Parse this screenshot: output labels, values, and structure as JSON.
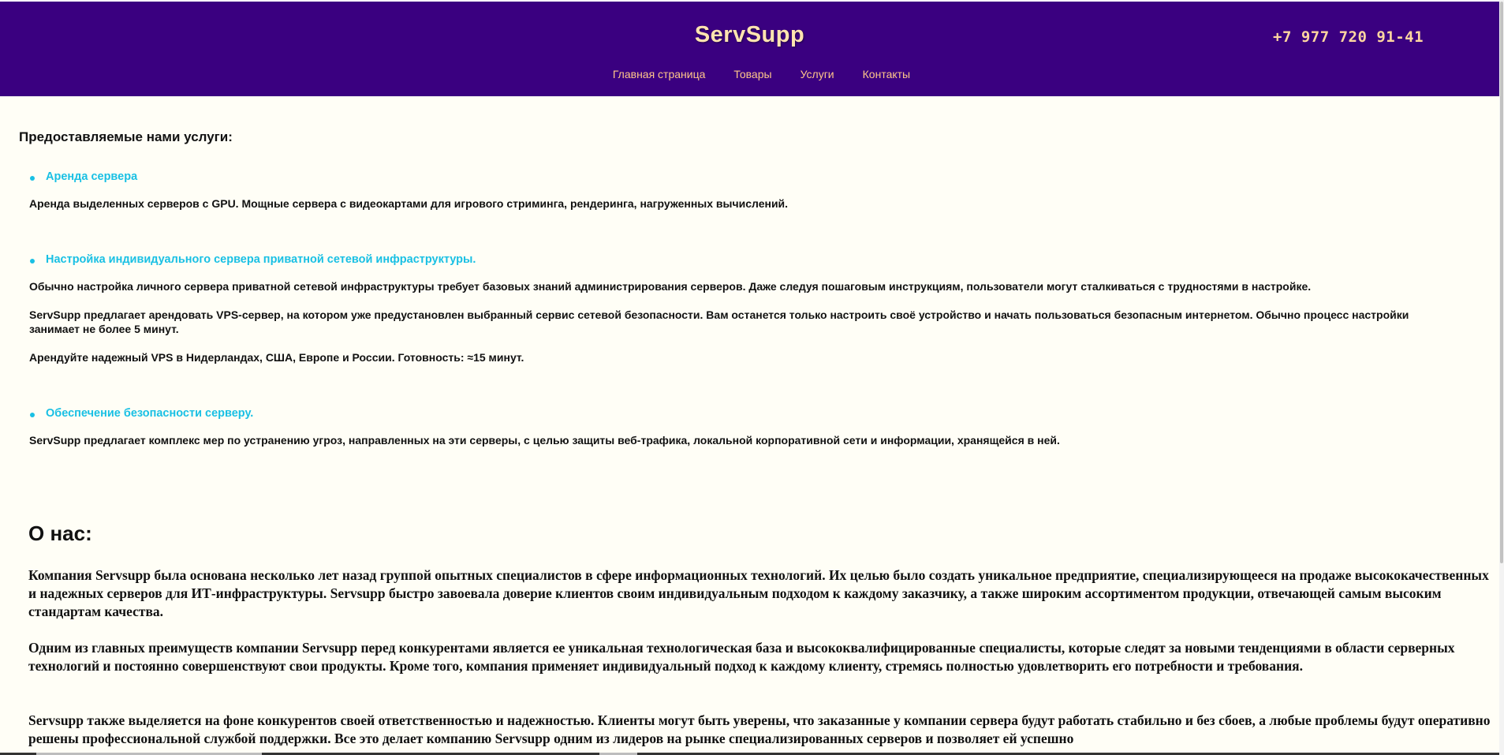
{
  "header": {
    "site_title": "ServSupp",
    "phone": "+7 977 720 91-41",
    "nav": [
      {
        "label": "Главная страница"
      },
      {
        "label": "Товары"
      },
      {
        "label": "Услуги"
      },
      {
        "label": "Контакты"
      }
    ]
  },
  "services": {
    "title": "Предоставляемые нами услуги:",
    "items": [
      {
        "heading": "Аренда сервера",
        "paragraphs": [
          "Аренда выделенных серверов с GPU. Мощные сервера с видеокартами для игрового стриминга, рендеринга, нагруженных вычислений."
        ]
      },
      {
        "heading": "Настройка индивидуального сервера приватной сетевой инфраструктуры.",
        "paragraphs": [
          "Обычно настройка личного сервера приватной сетевой инфраструктуры требует базовых знаний администрирования серверов. Даже следуя пошаговым инструкциям, пользователи могут сталкиваться с трудностями в настройке.",
          "ServSupp предлагает арендовать VPS-сервер, на котором уже предустановлен выбранный сервис сетевой безопасности. Вам останется только настроить своё устройство и начать пользоваться безопасным интернетом. Обычно процесс настройки занимает не более 5 минут.",
          "Арендуйте надежный VPS в Нидерландах, США, Европе и России. Готовность: ≈15 минут."
        ]
      },
      {
        "heading": "Обеспечение безопасности серверу.",
        "paragraphs": [
          "ServSupp предлагает комплекс мер по устранению угроз, направленных на эти серверы, с целью защиты веб-трафика, локальной корпоративной сети и информации, хранящейся в ней."
        ]
      }
    ]
  },
  "about": {
    "title": "О нас:",
    "paragraphs": [
      "Компания Servsupp была основана несколько лет назад группой опытных специалистов в сфере информационных технологий. Их целью было создать уникальное предприятие, специализирующееся на продаже высококачественных и надежных серверов для ИТ-инфраструктуры. Servsupp быстро завоевала доверие клиентов своим индивидуальным подходом к каждому заказчику, а также широким ассортиментом продукции, отвечающей самым высоким стандартам качества.",
      "Одним из главных преимуществ компании Servsupp перед конкурентами является ее уникальная технологическая база и высококвалифицированные специалисты, которые следят за новыми тенденциями в области серверных технологий и постоянно совершенствуют свои продукты. Кроме того, компания применяет индивидуальный подход к каждому клиенту, стремясь полностью удовлетворить его потребности и требования.",
      "Servsupp также выделяется на фоне конкурентов своей ответственностью и надежностью. Клиенты могут быть уверены, что заказанные у компании сервера будут работать стабильно и без сбоев, а любые проблемы будут оперативно решены профессиональной службой поддержки. Все это делает компанию Servsupp одним из лидеров на рынке специализированных серверов и позволяет ей успешно"
    ]
  },
  "colors": {
    "header_bg": "#3a0080",
    "title": "#ffe4b0",
    "nav_link": "#ffc68a",
    "service_heading": "#19c0e4",
    "page_bg": "#fffef6"
  }
}
